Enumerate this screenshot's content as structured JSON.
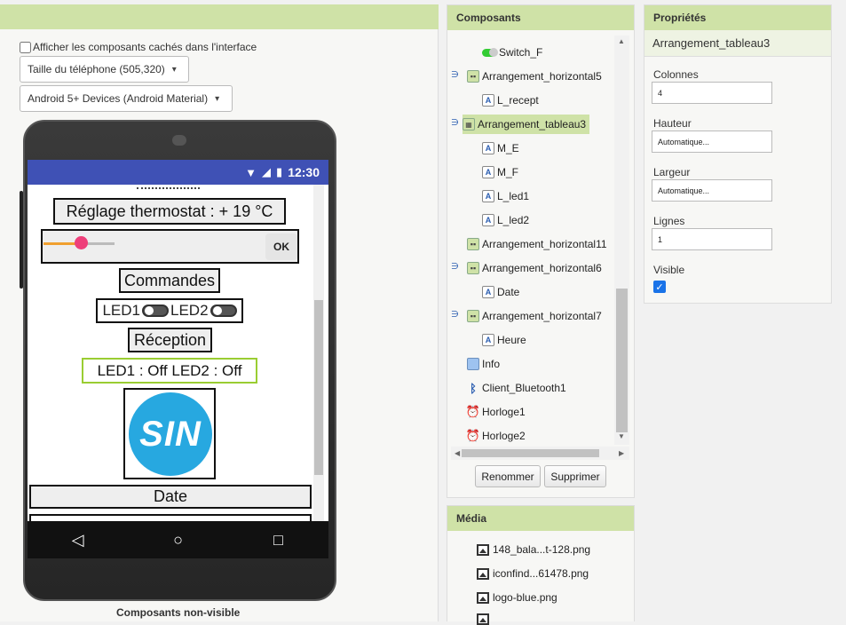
{
  "viewer": {
    "hidden_components_label": "Afficher les composants cachés dans l'interface",
    "phone_size": "Taille du téléphone (505,320)",
    "theme": "Android 5+ Devices (Android Material)",
    "nonvisible_label": "Composants non-visible"
  },
  "screen": {
    "time": "12:30",
    "thermostat_label": "Réglage thermostat : +   19   °C",
    "slider_value": 0.45,
    "ok_label": "OK",
    "commandes_label": "Commandes",
    "led1_label": "LED1",
    "led2_label": "LED2",
    "reception_label": "Réception",
    "reception_value": "LED1 : Off   LED2 : Off",
    "logo_text": "SIN",
    "date_label": "Date"
  },
  "components": {
    "title": "Composants",
    "tree": [
      {
        "label": "Switch_F",
        "icon": "switch-icon",
        "toggle": ""
      },
      {
        "label": "Arrangement_horizontal5",
        "icon": "horizontal-arrangement-icon",
        "toggle": "∋"
      },
      {
        "label": "L_recept",
        "icon": "label-icon",
        "toggle": ""
      },
      {
        "label": "Arrangement_tableau3",
        "icon": "table-arrangement-icon",
        "toggle": "∋"
      },
      {
        "label": "M_E",
        "icon": "label-icon",
        "toggle": ""
      },
      {
        "label": "M_F",
        "icon": "label-icon",
        "toggle": ""
      },
      {
        "label": "L_led1",
        "icon": "label-icon",
        "toggle": ""
      },
      {
        "label": "L_led2",
        "icon": "label-icon",
        "toggle": ""
      },
      {
        "label": "Arrangement_horizontal11",
        "icon": "horizontal-arrangement-icon",
        "toggle": ""
      },
      {
        "label": "Arrangement_horizontal6",
        "icon": "horizontal-arrangement-icon",
        "toggle": "∋"
      },
      {
        "label": "Date",
        "icon": "label-icon",
        "toggle": ""
      },
      {
        "label": "Arrangement_horizontal7",
        "icon": "horizontal-arrangement-icon",
        "toggle": "∋"
      },
      {
        "label": "Heure",
        "icon": "label-icon",
        "toggle": ""
      },
      {
        "label": "Info",
        "icon": "notifier-icon",
        "toggle": ""
      },
      {
        "label": "Client_Bluetooth1",
        "icon": "bluetooth-icon",
        "toggle": ""
      },
      {
        "label": "Horloge1",
        "icon": "clock-icon",
        "toggle": ""
      },
      {
        "label": "Horloge2",
        "icon": "clock-icon",
        "toggle": ""
      }
    ],
    "selected": "Arrangement_tableau3",
    "rename_label": "Renommer",
    "delete_label": "Supprimer"
  },
  "media": {
    "title": "Média",
    "files": [
      "148_bala...t-128.png",
      "iconfind...61478.png",
      "logo-blue.png"
    ]
  },
  "properties": {
    "title": "Propriétés",
    "component_name": "Arrangement_tableau3",
    "colonnes_label": "Colonnes",
    "colonnes_value": "4",
    "hauteur_label": "Hauteur",
    "hauteur_value": "Automatique...",
    "largeur_label": "Largeur",
    "largeur_value": "Automatique...",
    "lignes_label": "Lignes",
    "lignes_value": "1",
    "visible_label": "Visible",
    "visible_checked": true
  },
  "colors": {
    "header_green": "#cfe2a7",
    "status_bar": "#3f51b5",
    "slider_knob": "#ee3f7a",
    "logo_blue": "#27a8e0",
    "reception_border": "#9acd32"
  }
}
